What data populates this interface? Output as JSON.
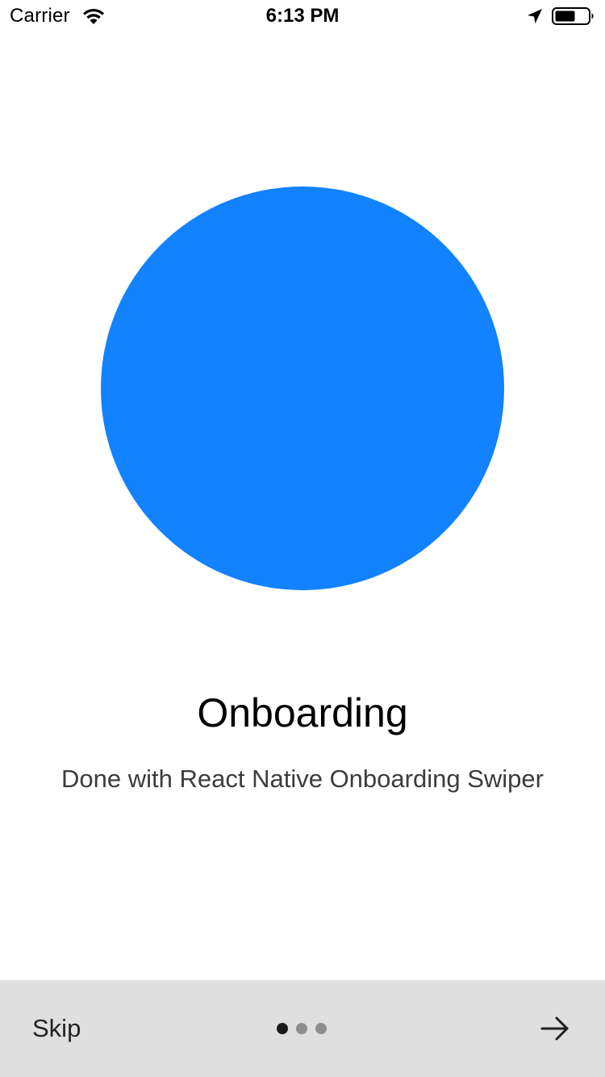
{
  "status_bar": {
    "carrier": "Carrier",
    "time": "6:13 PM",
    "icons": [
      "wifi-icon",
      "location-arrow-icon",
      "battery-icon"
    ]
  },
  "hero": {
    "circle_color": "#1282FF",
    "title": "Onboarding",
    "subtitle": "Done with React Native Onboarding Swiper"
  },
  "footer": {
    "background": "#DFDFDF",
    "skip_label": "Skip",
    "pagination": {
      "total_pages": 3,
      "current_page": 1,
      "active_color": "#1A1A1A",
      "inactive_color": "#8E8E8E"
    },
    "next_icon": "arrow-right-icon"
  }
}
